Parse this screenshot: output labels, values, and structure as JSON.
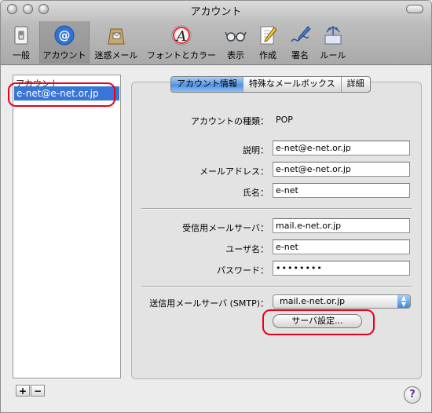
{
  "window": {
    "title": "アカウント"
  },
  "toolbar": {
    "items": [
      {
        "label": "一般",
        "icon": "light-switch-icon"
      },
      {
        "label": "アカウント",
        "icon": "at-sign-icon",
        "selected": true
      },
      {
        "label": "迷惑メール",
        "icon": "junk-mail-bag-icon"
      },
      {
        "label": "フォントとカラー",
        "icon": "font-letter-a-icon"
      },
      {
        "label": "表示",
        "icon": "glasses-icon"
      },
      {
        "label": "作成",
        "icon": "pencil-paper-icon"
      },
      {
        "label": "署名",
        "icon": "pen-signature-icon"
      },
      {
        "label": "ルール",
        "icon": "rules-arrows-icon"
      }
    ]
  },
  "accounts": {
    "header": "アカウント",
    "items": [
      "e-net@e-net.or.jp"
    ],
    "add_label": "+",
    "remove_label": "−"
  },
  "tabs": [
    "アカウント情報",
    "特殊なメールボックス",
    "詳細"
  ],
  "account_info": {
    "type_label": "アカウントの種類：",
    "type_value": "POP",
    "description_label": "説明：",
    "description_value": "e-net@e-net.or.jp",
    "email_label": "メールアドレス：",
    "email_value": "e-net@e-net.or.jp",
    "name_label": "氏名：",
    "name_value": "e-net",
    "incoming_label": "受信用メールサーバ：",
    "incoming_value": "mail.e-net.or.jp",
    "username_label": "ユーザ名：",
    "username_value": "e-net",
    "password_label": "パスワード：",
    "password_value": "••••••••",
    "smtp_label": "送信用メールサーバ (SMTP)：",
    "smtp_value": "mail.e-net.or.jp",
    "server_settings_button": "サーバ設定..."
  },
  "help_label": "?",
  "colors": {
    "selection": "#3875d7",
    "highlight_oval": "#e8001c",
    "tab_selected": "#5c9ce6"
  }
}
